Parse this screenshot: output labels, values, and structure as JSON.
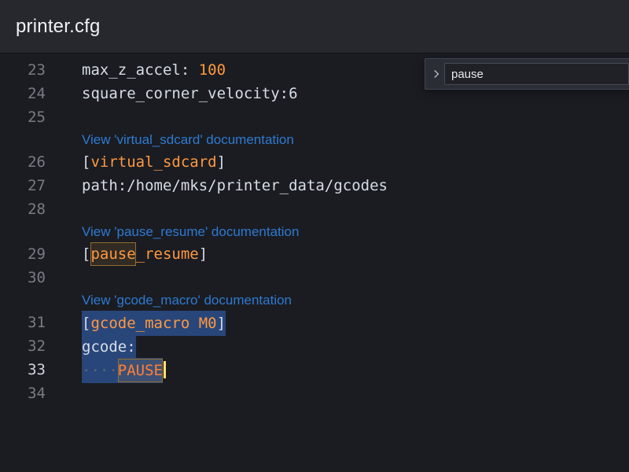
{
  "file": {
    "name": "printer.cfg"
  },
  "find": {
    "query": "pause"
  },
  "colors": {
    "accent": "#2f7ad0",
    "number": "#ff9a3c",
    "section": "#ff9840"
  },
  "editor": {
    "active_line": 33,
    "lines": [
      {
        "n": 23,
        "kind": "kv",
        "key": "max_z_accel",
        "sep": ": ",
        "val": "100",
        "val_type": "num"
      },
      {
        "n": 24,
        "kind": "kv",
        "key": "square_corner_velocity",
        "sep": ":",
        "val": "6"
      },
      {
        "n": 25,
        "kind": "blank"
      },
      {
        "kind": "lens",
        "text": "View 'virtual_sdcard' documentation"
      },
      {
        "n": 26,
        "kind": "section",
        "name": "virtual_sdcard"
      },
      {
        "n": 27,
        "kind": "kv",
        "key": "path",
        "sep": ":",
        "val": "/home/mks/printer_data/gcodes"
      },
      {
        "n": 28,
        "kind": "blank"
      },
      {
        "kind": "lens",
        "text": "View 'pause_resume' documentation"
      },
      {
        "n": 29,
        "kind": "section",
        "name": "pause_resume",
        "match": "pause"
      },
      {
        "n": 30,
        "kind": "blank"
      },
      {
        "kind": "lens",
        "text": "View 'gcode_macro' documentation"
      },
      {
        "n": 31,
        "kind": "section",
        "name": "gcode_macro M0",
        "selected": true
      },
      {
        "n": 32,
        "kind": "kv",
        "key": "gcode",
        "sep": ":",
        "val": "",
        "selected_key": true
      },
      {
        "n": 33,
        "kind": "indented",
        "text": "PAUSE",
        "selected": true,
        "match": "PAUSE",
        "caret_after": true
      },
      {
        "n": 34,
        "kind": "blank"
      }
    ]
  }
}
